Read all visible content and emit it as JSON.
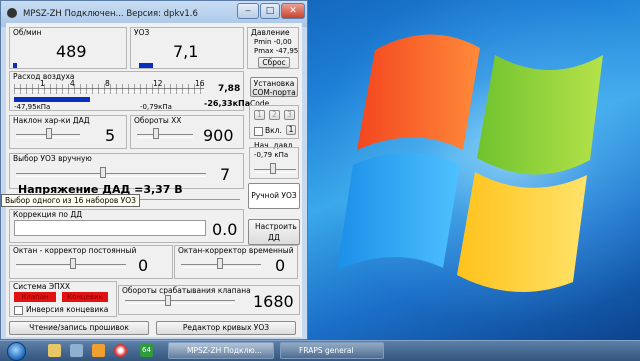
{
  "window": {
    "title": "MPSZ-ZH  Подключен...  Версия: dpkv1.6"
  },
  "rpm": {
    "label": "Об/мин",
    "value": "489"
  },
  "uoz": {
    "label": "УОЗ",
    "value": "7,1"
  },
  "pressure": {
    "label": "Давление",
    "pmin": "Pmin -0,00",
    "pmax": "Pmax -47,95",
    "reset": "Сброс"
  },
  "air": {
    "label": "Расход воздуха",
    "ticks": [
      "1",
      "4",
      "8",
      "12",
      "16"
    ],
    "left": "-47,95кПа",
    "mid": "-0,79кПа",
    "val1": "7,88",
    "val2": "-26,33кПа",
    "level": 0.4
  },
  "com": {
    "label": "Установка COM-порта"
  },
  "code": {
    "label": "Code",
    "k1": "1",
    "k2": "2",
    "k3": "3",
    "on": "Вкл.",
    "num": "1"
  },
  "dad_slope": {
    "label": "Наклон хар-ки ДАД",
    "value": "5"
  },
  "idle": {
    "label": "Обороты ХХ",
    "value": "900"
  },
  "init_press": {
    "label": "Нач. давл.",
    "value": "-0,79 кПа"
  },
  "uoz_select": {
    "label": "Выбор УОЗ вручную",
    "value": "7"
  },
  "voltage": {
    "text": "Напряжение ДАД =3,37 В"
  },
  "tooltip": "Выбор одного из 16 наборов УОЗ",
  "manual_btn": "Ручной УОЗ",
  "correction": {
    "label": "Коррекция по ДД",
    "value": "0.0"
  },
  "setup_btn": "Настроить ДД",
  "octane_const": {
    "label": "Октан - корректор постоянный",
    "value": "0"
  },
  "octane_temp": {
    "label": "Октан-корректор временный",
    "value": "0"
  },
  "epkh": {
    "label": "Система ЭПХХ",
    "valve": "Клапан",
    "limit": "Концевик",
    "inverse": "Инверсия концевика"
  },
  "valve_rpm": {
    "label": "Обороты срабатывания клапана",
    "value": "1680"
  },
  "bottom": {
    "flash": "Чтение/запись прошивок",
    "editor": "Редактор кривых УОЗ"
  },
  "taskbar": {
    "task1": "MPSZ-ZH  Подклю...",
    "task2": "FRAPS general",
    "badge": "64"
  }
}
